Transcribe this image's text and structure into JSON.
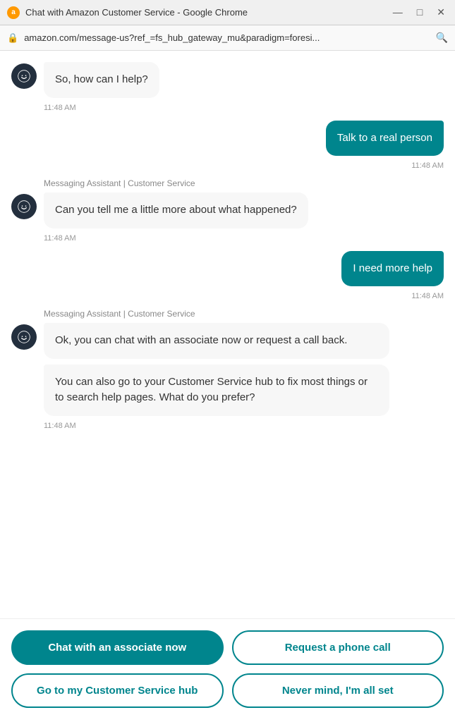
{
  "titleBar": {
    "icon": "a",
    "title": "Chat with Amazon Customer Service - Google Chrome",
    "minimize": "—",
    "maximize": "□",
    "close": "✕"
  },
  "addressBar": {
    "lock": "🔒",
    "url": "amazon.com/message-us?ref_=fs_hub_gateway_mu&paradigm=foresi...",
    "search": "🔍"
  },
  "messages": [
    {
      "id": "msg1",
      "type": "bot",
      "hasAvatar": true,
      "text": "So, how can I help?",
      "timestamp": "11:48 AM"
    },
    {
      "id": "msg2",
      "type": "user",
      "text": "Talk to a real person",
      "timestamp": "11:48 AM"
    },
    {
      "id": "msg3",
      "type": "bot",
      "hasAvatar": true,
      "assistantLabel": "Messaging Assistant | Customer Service",
      "text": "Can you tell me a little more about what happened?",
      "timestamp": "11:48 AM"
    },
    {
      "id": "msg4",
      "type": "user",
      "text": "I need more help",
      "timestamp": "11:48 AM"
    },
    {
      "id": "msg5",
      "type": "bot",
      "hasAvatar": true,
      "assistantLabel": "Messaging Assistant | Customer Service",
      "bubbles": [
        "Ok, you can chat with an associate now or request a call back.",
        "You can also go to your Customer Service hub to fix most things or to search help pages. What do you prefer?"
      ],
      "timestamp": "11:48 AM"
    }
  ],
  "actions": {
    "row1": [
      {
        "id": "chat-now",
        "label": "Chat with an associate now",
        "style": "filled"
      },
      {
        "id": "phone-call",
        "label": "Request a phone call",
        "style": "outline"
      }
    ],
    "row2": [
      {
        "id": "cs-hub",
        "label": "Go to my Customer Service hub",
        "style": "outline"
      },
      {
        "id": "nevermind",
        "label": "Never mind, I'm all set",
        "style": "outline"
      }
    ]
  }
}
